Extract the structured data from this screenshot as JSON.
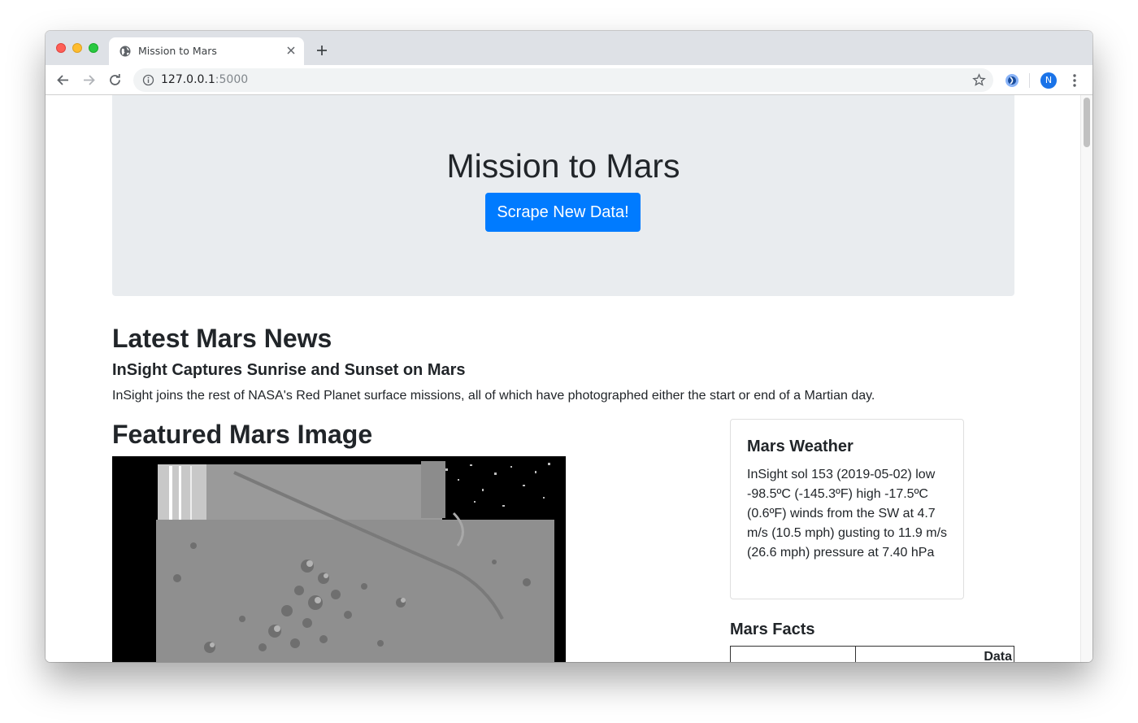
{
  "browser": {
    "tab_title": "Mission to Mars",
    "url_host": "127.0.0.1",
    "url_port": ":5000",
    "avatar_initial": "N"
  },
  "jumbotron": {
    "title": "Mission to Mars",
    "button_label": "Scrape New Data!"
  },
  "news": {
    "heading": "Latest Mars News",
    "title": "InSight Captures Sunrise and Sunset on Mars",
    "paragraph": "InSight joins the rest of NASA's Red Planet surface missions, all of which have photographed either the start or end of a Martian day."
  },
  "featured": {
    "heading": "Featured Mars Image"
  },
  "weather": {
    "title": "Mars Weather",
    "text": "InSight sol 153 (2019-05-02) low -98.5ºC (-145.3ºF) high -17.5ºC (0.6ºF) winds from the SW at 4.7 m/s (10.5 mph) gusting to 11.9 m/s (26.6 mph) pressure at 7.40 hPa"
  },
  "facts": {
    "heading": "Mars Facts",
    "columns": [
      "",
      "Data"
    ]
  },
  "colors": {
    "primary_button": "#007bff",
    "jumbotron_bg": "#e9ecef",
    "text": "#212529"
  }
}
